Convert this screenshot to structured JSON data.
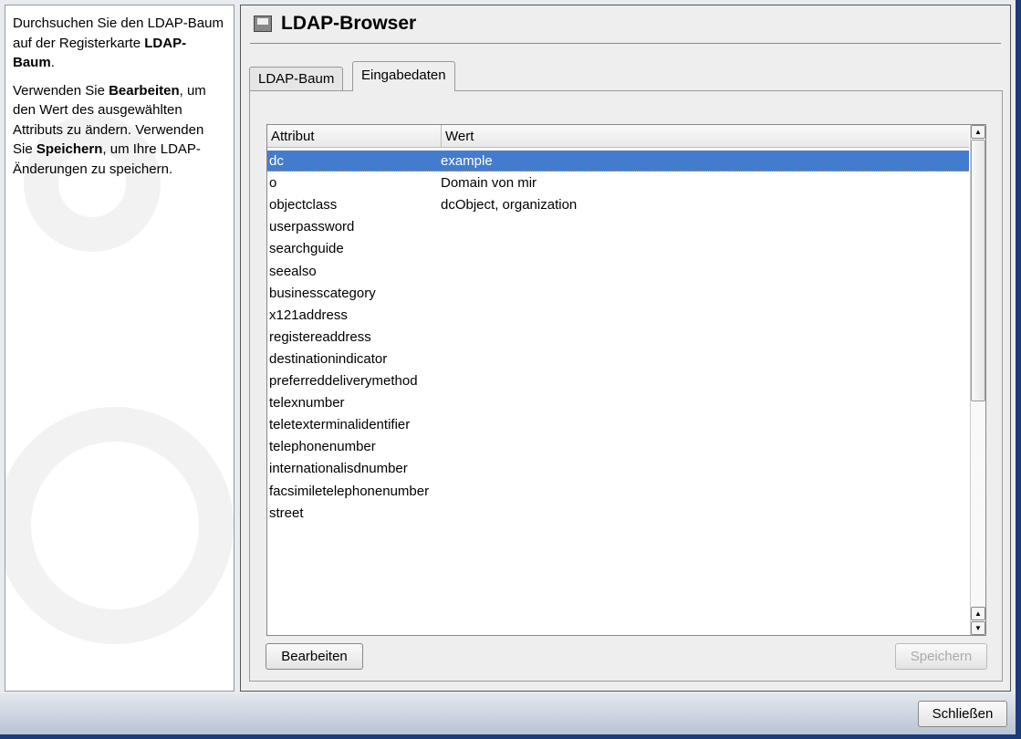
{
  "help": {
    "p1a": "Durchsuchen Sie den LDAP-Baum auf der Registerkarte ",
    "p1b": "LDAP-Baum",
    "p1c": ".",
    "p2a": "Verwenden Sie ",
    "p2b": "Bearbeiten",
    "p2c": ", um den Wert des ausgewählten Attributs zu ändern. Verwenden Sie ",
    "p2d": "Speichern",
    "p2e": ", um Ihre LDAP-Änderungen zu speichern."
  },
  "title": "LDAP-Browser",
  "tabs": [
    {
      "label": "LDAP-Baum"
    },
    {
      "label": "Eingabedaten"
    }
  ],
  "table": {
    "columns": [
      "Attribut",
      "Wert"
    ],
    "rows": [
      [
        "dc",
        "example"
      ],
      [
        "o",
        "Domain von mir"
      ],
      [
        "objectclass",
        "dcObject, organization"
      ],
      [
        "userpassword",
        ""
      ],
      [
        "searchguide",
        ""
      ],
      [
        "seealso",
        ""
      ],
      [
        "businesscategory",
        ""
      ],
      [
        "x121address",
        ""
      ],
      [
        "registereaddress",
        ""
      ],
      [
        "destinationindicator",
        ""
      ],
      [
        "preferreddeliverymethod",
        ""
      ],
      [
        "telexnumber",
        ""
      ],
      [
        "teletexterminalidentifier",
        ""
      ],
      [
        "telephonenumber",
        ""
      ],
      [
        "internationalisdnumber",
        ""
      ],
      [
        "facsimiletelephonenumber",
        ""
      ],
      [
        "street",
        ""
      ]
    ]
  },
  "buttons": {
    "edit": "Bearbeiten",
    "save": "Speichern",
    "close": "Schließen"
  }
}
